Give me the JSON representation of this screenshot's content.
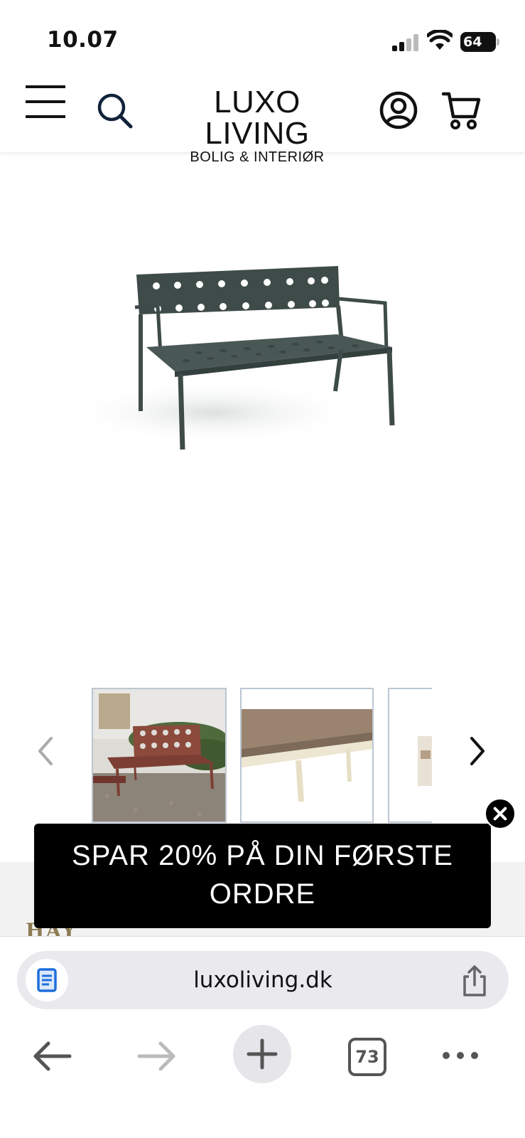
{
  "status": {
    "time": "10.07",
    "battery": "64"
  },
  "header": {
    "logo_title": "LUXO LIVING",
    "logo_subtitle": "BOLIG & INTERIØR",
    "icons": [
      "menu-icon",
      "search-icon",
      "account-icon",
      "cart-icon"
    ]
  },
  "gallery": {
    "thumbnails": [
      "bench-lifestyle-red",
      "bench-cushion-beige",
      "bench-partial"
    ]
  },
  "brand": {
    "name": "HAY"
  },
  "promo": {
    "line1": "SPAR 20% PÅ DIN FØRSTE",
    "line2": "ORDRE"
  },
  "browser": {
    "url": "luxoliving.dk",
    "tab_count": "73"
  },
  "colors": {
    "bench": "#3d4a47",
    "promo_bg": "#000000",
    "brand_gold": "#8c7a52"
  }
}
